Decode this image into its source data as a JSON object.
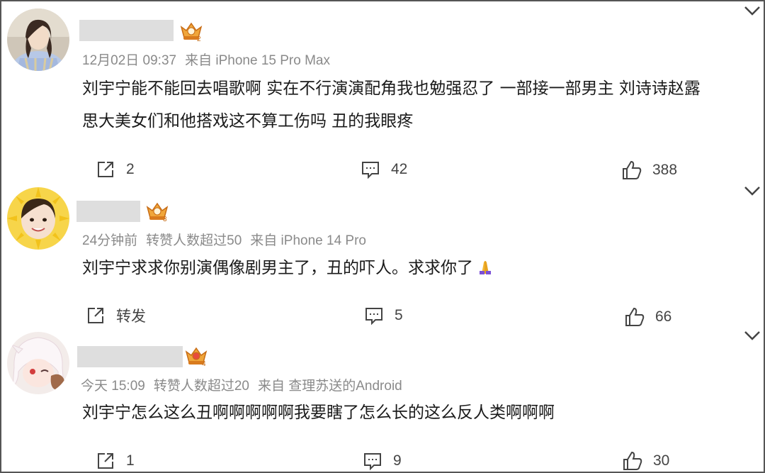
{
  "comments": [
    {
      "meta": [
        "12月02日 09:37",
        "来自 iPhone 15 Pro Max"
      ],
      "text_lines": [
        "刘宇宁能不能回去唱歌啊 实在不行演演配角我也勉强忍了 一部接一部男主 刘诗诗赵露",
        "思大美女们和他搭戏这不算工伤吗 丑的我眼疼"
      ],
      "share": "2",
      "comments_count": "42",
      "likes": "388",
      "badge_level": "2"
    },
    {
      "meta": [
        "24分钟前",
        "转赞人数超过50",
        "来自 iPhone 14 Pro"
      ],
      "text_lines": [
        "刘宇宁求求你别演偶像剧男主了，丑的吓人。求求你了"
      ],
      "share": "转发",
      "comments_count": "5",
      "likes": "66",
      "badge_level": "3"
    },
    {
      "meta": [
        "今天 15:09",
        "转赞人数超过20",
        "来自 查理苏送的Android"
      ],
      "text_lines": [
        "刘宇宁怎么这么丑啊啊啊啊啊我要瞎了怎么长的这么反人类啊啊啊"
      ],
      "share": "1",
      "comments_count": "9",
      "likes": "30",
      "badge_level": "4"
    }
  ],
  "icons": {
    "share": "share-icon",
    "comment": "comment-icon",
    "like": "thumbs-up-icon",
    "more": "chevron-down-icon",
    "badge": "crown-badge-icon"
  },
  "colors": {
    "meta": "#8a8a8a",
    "badge": "#e8962e",
    "placeholder": "#dedede"
  }
}
